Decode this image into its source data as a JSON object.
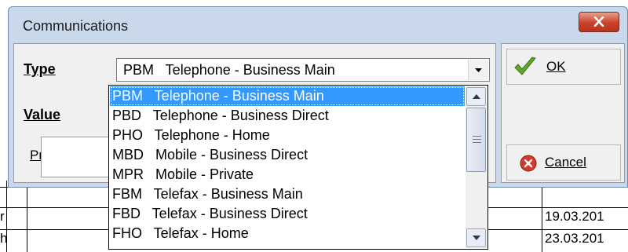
{
  "dialog": {
    "title": "Communications",
    "type_label": "Type",
    "value_label": "Value",
    "primary_label": "Primary",
    "selected_type": "PBM   Telephone - Business Main"
  },
  "buttons": {
    "ok_label": "OK",
    "cancel_label": "Cancel"
  },
  "dropdown": {
    "items": [
      "PBM   Telephone - Business Main",
      "PBD   Telephone - Business Direct",
      "PHO   Telephone - Home",
      "MBD   Mobile - Business Direct",
      "MPR   Mobile - Private",
      "FBM   Telefax - Business Main",
      "FBD   Telefax - Business Direct",
      "FHO   Telefax - Home"
    ]
  },
  "background": {
    "date_1": "19.03.201",
    "date_2": "23.03.201",
    "cut_text_1": "r",
    "cut_text_2": "h"
  },
  "colors": {
    "selection": "#3399ff",
    "dialog_frame": "#c9d8ea",
    "close_button": "#c9432a"
  }
}
